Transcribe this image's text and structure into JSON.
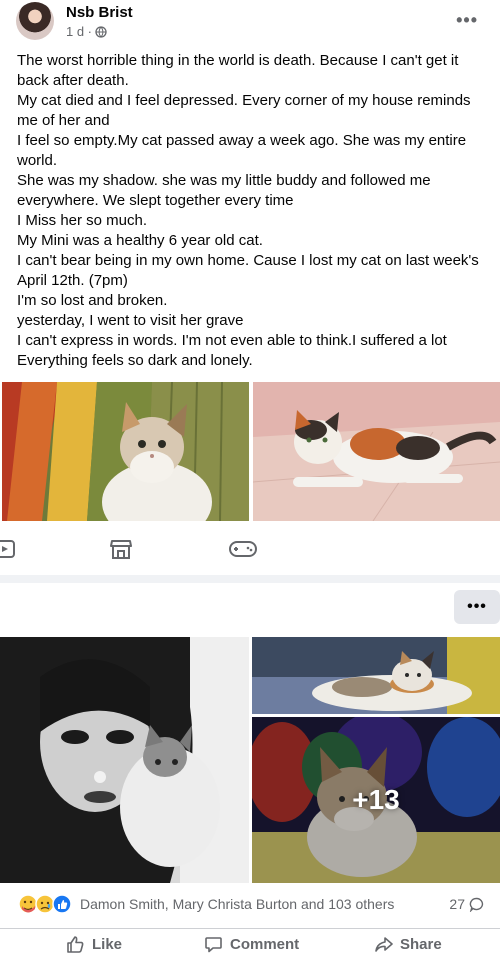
{
  "post": {
    "author": "Nsb Brist",
    "time": "1 d ·",
    "more_label": "•••",
    "paragraphs": [
      "The worst horrible thing in the world is death. Because I can't get it back after death.",
      "My cat died and I feel depressed. Every corner of my house reminds me of her and",
      "I feel so empty.My cat passed away a week ago. She was my entire world.",
      "She was my shadow. she was my little buddy and followed me everywhere. We slept together every time",
      "I Miss her so much.",
      "My Mini was a healthy 6 year old cat.",
      "I can't bear being in my own home. Cause I lost my cat on last week's April 12th. (7pm)",
      "I'm so lost and broken.",
      "yesterday, I went to visit her grave",
      "I can't express in words. I'm not even able to think.I suffered a lot",
      "Everything feels so dark and lonely."
    ]
  },
  "strip_icons": [
    "watch-icon",
    "marketplace-icon",
    "gaming-icon"
  ],
  "second_post": {
    "more_label": "•••",
    "more_photos": "+13"
  },
  "reactions": {
    "icons": [
      "care-emoji-icon",
      "sad-emoji-icon",
      "like-emoji-icon"
    ],
    "names": "Damon Smith, Mary Christa Burton and 103 others",
    "comment_count": "27"
  },
  "actions": {
    "like": "Like",
    "comment": "Comment",
    "share": "Share"
  },
  "colors": {
    "text": "#050505",
    "secondary": "#65676b",
    "divider": "#ced0d4",
    "like_blue": "#1877f2"
  }
}
